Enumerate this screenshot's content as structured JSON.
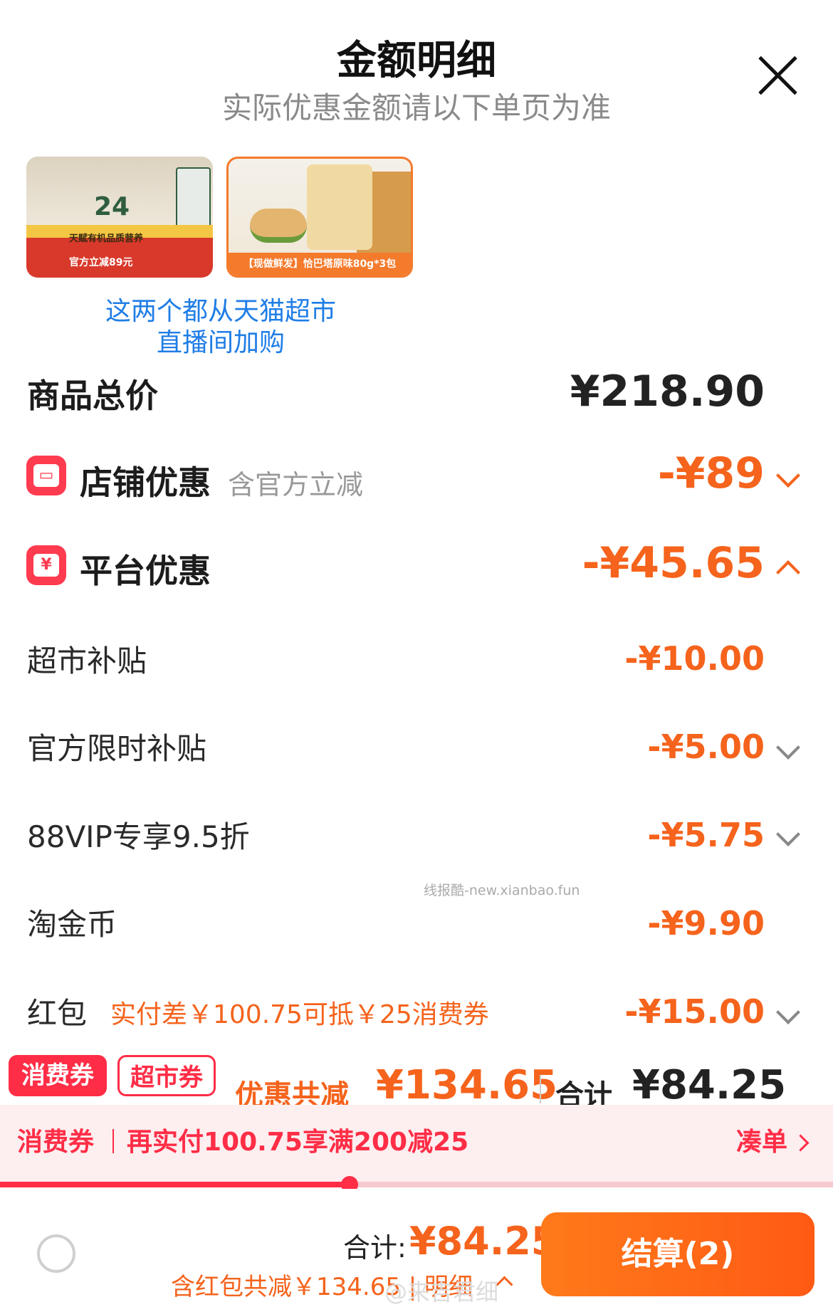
{
  "header": {
    "title": "金额明细",
    "subtitle": "实际优惠金额请以下单页为准"
  },
  "products": [
    {
      "badge_number": "24",
      "line1": "天赋有机品质营养",
      "line2": "官方立减89元"
    },
    {
      "caption": "【现做鲜发】恰巴塔原味80g*3包"
    }
  ],
  "note": {
    "line1": "这两个都从天猫超市",
    "line2": "直播间加购"
  },
  "total_price": {
    "label": "商品总价",
    "value": "¥218.90"
  },
  "store_discount": {
    "label": "店铺优惠",
    "sub": "含官方立减",
    "value": "-¥89",
    "icon": "store-icon"
  },
  "platform_discount": {
    "label": "平台优惠",
    "value": "-¥45.65",
    "icon": "yuan-icon"
  },
  "items": [
    {
      "label": "超市补贴",
      "value": "-¥10.00"
    },
    {
      "label": "官方限时补贴",
      "value": "-¥5.00"
    },
    {
      "label": "88VIP专享9.5折",
      "value": "-¥5.75"
    },
    {
      "label": "淘金币",
      "value": "-¥9.90"
    },
    {
      "label": "红包",
      "hint": "实付差￥100.75可抵￥25消费券",
      "value": "-¥15.00"
    }
  ],
  "watermark": "线报酷-new.xianbao.fun",
  "coupons": {
    "tag1": "消费券",
    "tag2": "超市券",
    "saved_label": "优惠共减",
    "saved_value": "¥134.65",
    "total_label": "合计",
    "total_value": "¥84.25"
  },
  "progress": {
    "tag": "消费券",
    "text": "再实付100.75享满200减25",
    "link": "凑单",
    "fraction": 0.42
  },
  "footer": {
    "total_label": "合计:",
    "total_value": "¥84.25",
    "detail": "含红包共减￥134.65 | 明细",
    "checkout": "结算(2)",
    "credit": "@来吉君细"
  },
  "colors": {
    "accent": "#f5631c",
    "red": "#ff2d46",
    "link": "#1f7de6"
  }
}
